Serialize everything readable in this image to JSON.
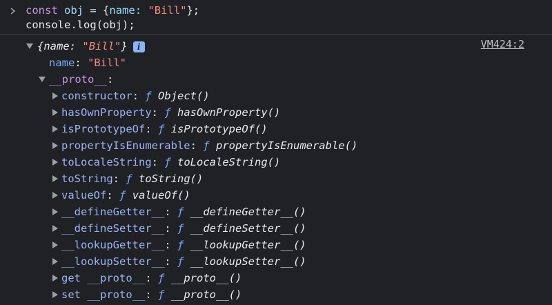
{
  "input": {
    "line1": {
      "kw": "const",
      "ident": "obj",
      "eq": "=",
      "open": "{",
      "key": "name:",
      "str": "\"Bill\"",
      "close": "};"
    },
    "line2": {
      "obj": "console",
      "dot": ".",
      "method": "log",
      "args": "(obj);"
    }
  },
  "source_link": "VM424:2",
  "output": {
    "preview": {
      "open": "{",
      "key": "name:",
      "str": "\"Bill\"",
      "close": "}",
      "badge": "i"
    },
    "name_row": {
      "key": "name",
      "colon": ":",
      "value": "\"Bill\""
    },
    "proto_row": {
      "key": "__proto__",
      "colon": ":"
    },
    "proto_items": [
      {
        "key": "constructor",
        "f": "ƒ",
        "fn": "Object()"
      },
      {
        "key": "hasOwnProperty",
        "f": "ƒ",
        "fn": "hasOwnProperty()"
      },
      {
        "key": "isPrototypeOf",
        "f": "ƒ",
        "fn": "isPrototypeOf()"
      },
      {
        "key": "propertyIsEnumerable",
        "f": "ƒ",
        "fn": "propertyIsEnumerable()"
      },
      {
        "key": "toLocaleString",
        "f": "ƒ",
        "fn": "toLocaleString()"
      },
      {
        "key": "toString",
        "f": "ƒ",
        "fn": "toString()"
      },
      {
        "key": "valueOf",
        "f": "ƒ",
        "fn": "valueOf()"
      },
      {
        "key": "__defineGetter__",
        "f": "ƒ",
        "fn": "__defineGetter__()"
      },
      {
        "key": "__defineSetter__",
        "f": "ƒ",
        "fn": "__defineSetter__()"
      },
      {
        "key": "__lookupGetter__",
        "f": "ƒ",
        "fn": "__lookupGetter__()"
      },
      {
        "key": "__lookupSetter__",
        "f": "ƒ",
        "fn": "__lookupSetter__()"
      },
      {
        "key": "get __proto__",
        "f": "ƒ",
        "fn": "__proto__()"
      },
      {
        "key": "set __proto__",
        "f": "ƒ",
        "fn": "__proto__()"
      }
    ]
  }
}
